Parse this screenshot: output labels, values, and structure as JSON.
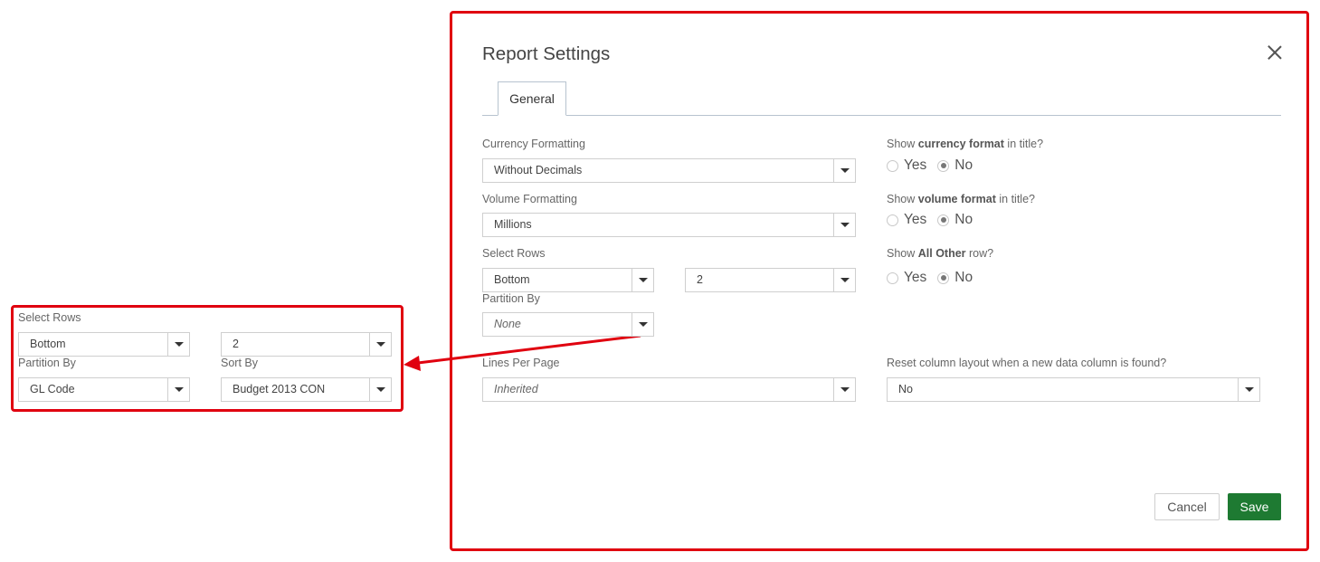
{
  "dialog": {
    "title": "Report Settings",
    "tab_general": "General",
    "currency": {
      "label": "Currency Formatting",
      "value": "Without Decimals"
    },
    "volume": {
      "label": "Volume Formatting",
      "value": "Millions"
    },
    "select_rows": {
      "label": "Select Rows",
      "mode": "Bottom",
      "count": "2"
    },
    "partition": {
      "label": "Partition By",
      "value": "None"
    },
    "lines_per_page": {
      "label": "Lines Per Page",
      "value": "Inherited"
    },
    "show_currency": {
      "pre": "Show ",
      "bold": "currency format",
      "post": " in title?",
      "yes": "Yes",
      "no": "No",
      "selected": "No"
    },
    "show_volume": {
      "pre": "Show ",
      "bold": "volume format",
      "post": " in title?",
      "yes": "Yes",
      "no": "No",
      "selected": "No"
    },
    "show_all_other": {
      "pre": "Show ",
      "bold": "All Other",
      "post": " row?",
      "yes": "Yes",
      "no": "No",
      "selected": "No"
    },
    "reset_layout": {
      "label": "Reset column layout when a new data column is found?",
      "value": "No"
    },
    "cancel_label": "Cancel",
    "save_label": "Save"
  },
  "callout": {
    "select_rows": {
      "label": "Select Rows",
      "mode": "Bottom",
      "count": "2"
    },
    "partition": {
      "label": "Partition By",
      "value": "GL Code"
    },
    "sort": {
      "label": "Sort By",
      "value": "Budget 2013 CON"
    }
  },
  "colors": {
    "highlight": "#e0000f",
    "save": "#1e7a32"
  }
}
